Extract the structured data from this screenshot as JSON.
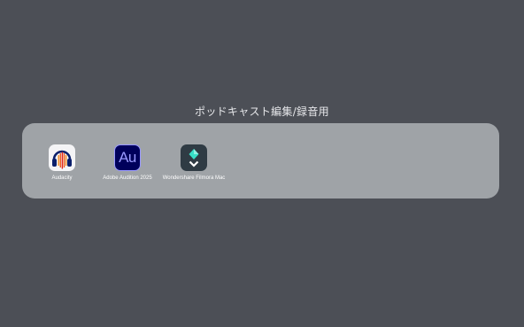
{
  "folder": {
    "title": "ポッドキャスト編集/録音用"
  },
  "apps": [
    {
      "label": "Audacity",
      "icon": "audacity-icon"
    },
    {
      "label": "Adobe Audition 2025",
      "icon": "adobe-audition-icon",
      "glyph": "Au"
    },
    {
      "label": "Wondershare Filmora Mac",
      "icon": "filmora-icon"
    }
  ],
  "colors": {
    "desktop_background": "#4c4f56",
    "folder_panel": "#9fa3a7",
    "audition_bg": "#00005b",
    "audition_accent": "#9999ff",
    "filmora_bg": "#2f3b44",
    "filmora_accent": "#37e0c8"
  }
}
